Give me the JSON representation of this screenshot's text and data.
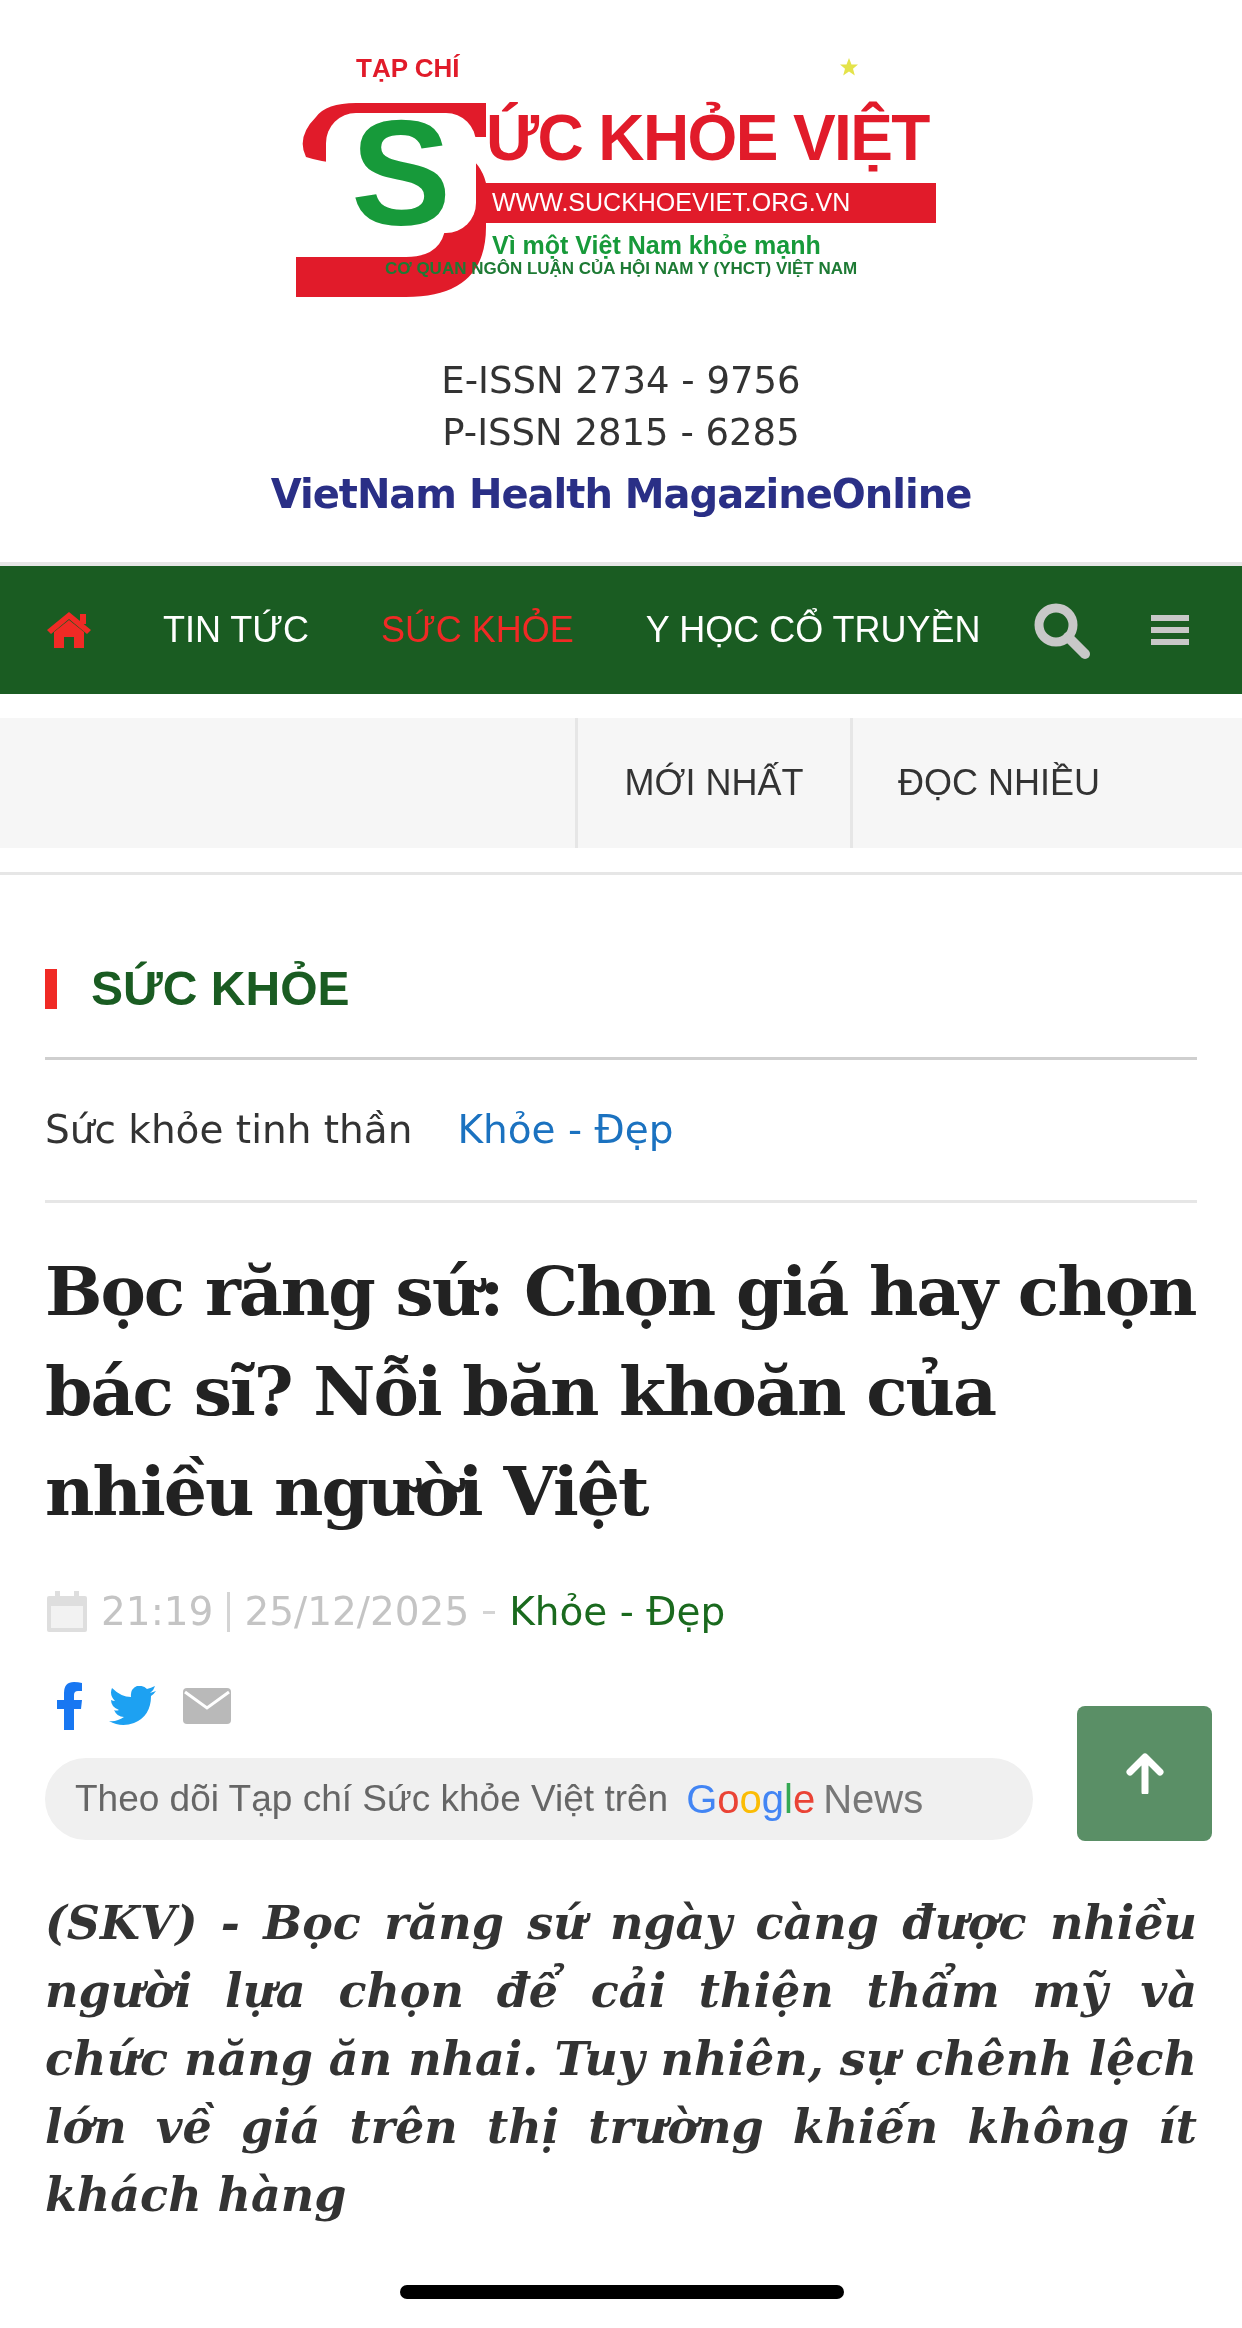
{
  "logo": {
    "kicker": "TẠP CHÍ",
    "initial": "S",
    "name": "ỨC KHỎE VIỆT",
    "url": "WWW.SUCKHOEVIET.ORG.VN",
    "slogan": "Vì một Việt Nam khỏe mạnh",
    "org": "CƠ QUAN NGÔN LUẬN CỦA HỘI NAM Y (YHCT) VIỆT NAM"
  },
  "issn": [
    "E-ISSN 2734 - 9756",
    "P-ISSN 2815 - 6285"
  ],
  "tagline": "VietNam Health MagazineOnline",
  "nav": {
    "items": [
      {
        "label": "TIN TỨC",
        "selected": false
      },
      {
        "label": "SỨC KHỎE",
        "selected": true
      },
      {
        "label": "Y HỌC CỔ TRUYỀN",
        "selected": false
      }
    ]
  },
  "subnav": [
    "MỚI NHẤT",
    "ĐỌC NHIỀU"
  ],
  "section": {
    "title": "SỨC KHỎE",
    "subcategories": [
      {
        "label": "Sức khỏe tinh thần",
        "selected": false
      },
      {
        "label": "Khỏe - Đẹp",
        "selected": true
      }
    ]
  },
  "article": {
    "title": "Bọc răng sứ: Chọn giá hay chọn bác sĩ? Nỗi băn khoăn của nhiều người Việt",
    "time": "21:19",
    "date": "25/12/2025",
    "category": "Khỏe - Đẹp",
    "follow": {
      "text": "Theo dõi Tạp chí Sức khỏe Việt trên",
      "brand": "Google",
      "product": "News"
    },
    "lead": "(SKV) - Bọc răng sứ ngày càng được nhiều người lựa chọn để cải thiện thẩm mỹ và chức năng ăn nhai. Tuy nhiên, sự chênh lệch lớn về giá trên thị trường khiến không ít khách hàng"
  }
}
